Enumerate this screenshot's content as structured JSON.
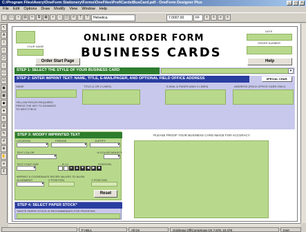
{
  "window": {
    "title": "C:\\Program Files\\Avery\\OneForm Stationery\\Forms\\OneFiles\\Prof\\Cards\\BusCard.pdf - OneForm Designer Plus"
  },
  "menu": [
    "File",
    "Edit",
    "Options",
    "Draw",
    "Modify",
    "View",
    "Window",
    "Help"
  ],
  "toolbar": {
    "font": "Helvetica",
    "size": "7.0007.00",
    "style": "FF"
  },
  "header": {
    "title1": "ONLINE ORDER FORM",
    "title2": "BUSINESS CARDS",
    "date_label": "DATE",
    "order_number_label": "ORDER NUMBER",
    "your_name_label": "YOUR NAME"
  },
  "buttons": {
    "order_start": "Order Start Page",
    "help": "Help",
    "reset": "Reset",
    "special_char": "SPECIAL CHAR."
  },
  "step1": {
    "label": "STEP 1: SELECT THE STYLE OF YOUR BUSINESS CARD"
  },
  "step2": {
    "label": "STEP 2: ENTER IMPRINT TEXT: NAME, TITLE, E-MAIL/PAGER, AND OPTIONAL FIELD OFFICE ADDRESS",
    "name_label": "NAME",
    "title_label": "TITLE (1 OR 2 LINES)",
    "email_label": "E-MAIL & PAGER (MAX 2 LINES)",
    "address_label": "ADDRESS (FIELD OFFICE CARD ONLY)",
    "note1": "YELLOW FIELDS REQUIRED",
    "note2": "PRESS THE KEY TO ADVANCE",
    "note3": "TO NEXT FIELD"
  },
  "step3": {
    "label": "STEP 3: MODIFY IMPRINTED TEXT",
    "location": "LOCATION",
    "phrase": "PHRASE",
    "justify": "JUSTIFY",
    "text_color": "TEXT COLOR",
    "color_density": "% COLOR DENSITY",
    "font_size": "TEXT FONT SIZE",
    "biu": "B   I   U",
    "position": "POSITION",
    "imprint_note": "IMPRINT & COORDINATE ENTER VALUES TO ALIGN",
    "alignment": "ALIGNMENT",
    "x_position": "X POSITION",
    "y_position": "Y POSITION"
  },
  "step4": {
    "label": "STEP 4: SELECT PAPER STOCK*",
    "note": "*WHITE PAPER STOCK IS RECOMMENDED FOR PROOFING"
  },
  "proof_label": "PLEASE PROOF YOUR BUSINESS CARD IMAGE FOR ACCURACY",
  "status": {
    "page": "P ABL1",
    "layer": "All On",
    "coords": "GridSnap Off/CompSnap On   7.578, 10.478",
    "mode": "Insrt"
  }
}
